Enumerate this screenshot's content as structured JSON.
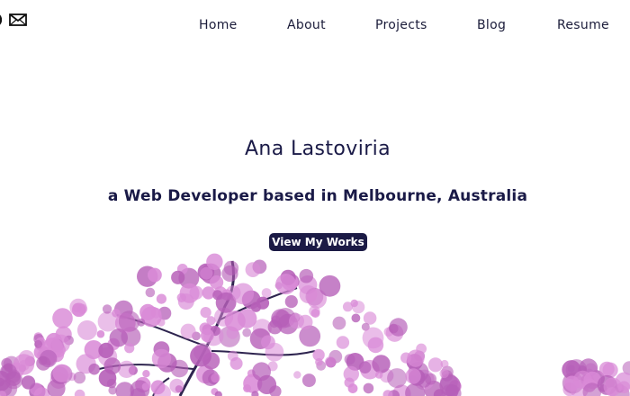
{
  "header": {
    "social": {
      "icons": [
        "partial-circle-icon",
        "envelope-icon"
      ]
    },
    "nav": {
      "items": [
        {
          "label": "Home"
        },
        {
          "label": "About"
        },
        {
          "label": "Projects"
        },
        {
          "label": "Blog"
        },
        {
          "label": "Resume"
        }
      ]
    }
  },
  "hero": {
    "name": "Ana Lastoviria",
    "tagline": "a Web Developer based in Melbourne, Australia",
    "cta_label": "View My Works"
  },
  "colors": {
    "text": "#1a1a47",
    "button_bg": "#1b1a45",
    "button_text": "#ffffff",
    "blossom": "#d98ad7",
    "blossom_dark": "#b65fb8",
    "branch": "#2e244f"
  },
  "image": {
    "name": "tree-blossom"
  }
}
